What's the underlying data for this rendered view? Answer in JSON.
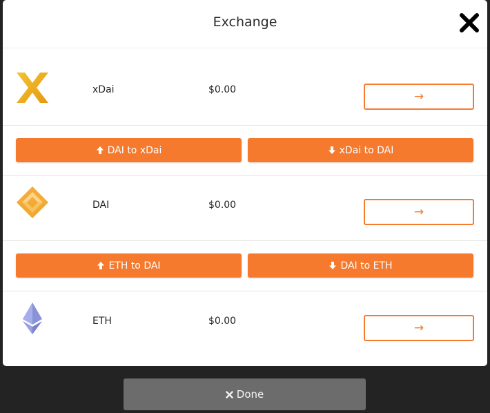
{
  "modal": {
    "title": "Exchange",
    "close_icon": "close-icon"
  },
  "assets": [
    {
      "name": "xDai",
      "balance": "$0.00",
      "icon": "xdai-logo-icon",
      "send_arrow": "→"
    },
    {
      "name": "DAI",
      "balance": "$0.00",
      "icon": "dai-logo-icon",
      "send_arrow": "→"
    },
    {
      "name": "ETH",
      "balance": "$0.00",
      "icon": "eth-logo-icon",
      "send_arrow": "→"
    }
  ],
  "bridges": [
    {
      "left_label": "DAI to xDai",
      "right_label": "xDai to DAI"
    },
    {
      "left_label": "ETH to DAI",
      "right_label": "DAI to ETH"
    }
  ],
  "footer": {
    "done_label": "Done"
  },
  "colors": {
    "accent": "#f67a2e",
    "done_button": "#6c6c6c",
    "backdrop": "#232323"
  }
}
